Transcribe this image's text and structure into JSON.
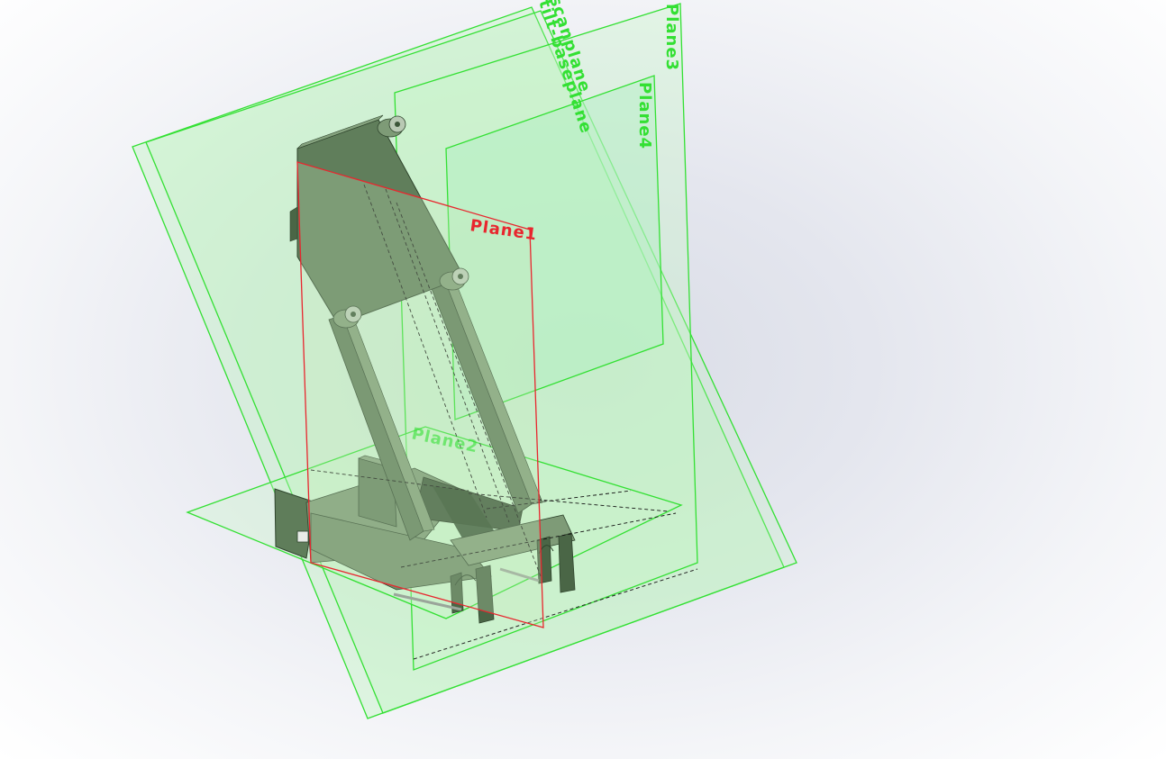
{
  "app": {
    "view": "3D model viewport"
  },
  "colors": {
    "plane_green": "#33e033",
    "plane_fill": "#b8f5b8",
    "plane_red": "#e8262e",
    "part_green": "#5f7d5a",
    "part_dark": "#3c5639",
    "part_light": "#86a37f"
  },
  "planes": {
    "plane1": "Plane1",
    "plane2": "Plane2",
    "plane3": "Plane3",
    "plane4": "Plane4",
    "scanplane": "scanplane",
    "tilt_baseplane": "tilt-baseplane"
  }
}
